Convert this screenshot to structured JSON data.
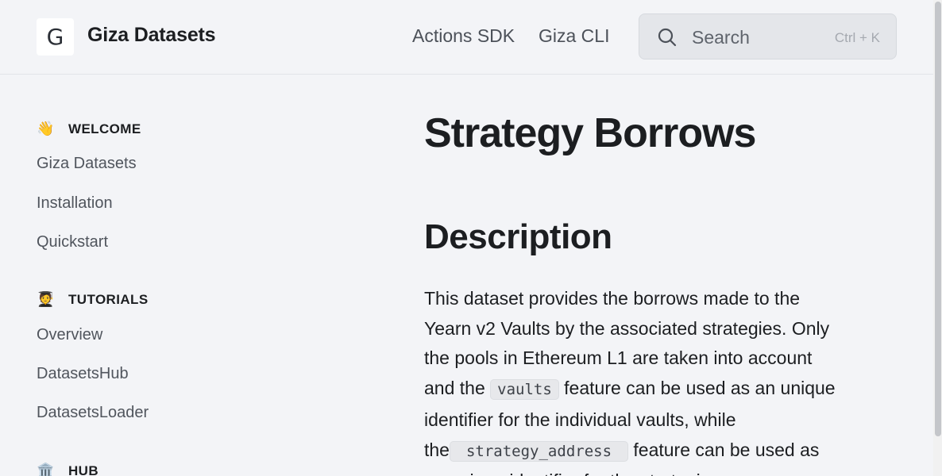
{
  "header": {
    "logo_letter": "G",
    "site_title": "Giza Datasets",
    "nav": [
      {
        "label": "Actions SDK"
      },
      {
        "label": "Giza CLI"
      }
    ],
    "search": {
      "placeholder": "Search",
      "shortcut": "Ctrl + K"
    }
  },
  "sidebar": {
    "sections": [
      {
        "emoji": "👋",
        "title": "WELCOME",
        "items": [
          "Giza Datasets",
          "Installation",
          "Quickstart"
        ]
      },
      {
        "emoji": "🧑‍🎓",
        "title": "TUTORIALS",
        "items": [
          "Overview",
          "DatasetsHub",
          "DatasetsLoader"
        ]
      },
      {
        "emoji": "🏛️",
        "title": "HUB",
        "items": []
      }
    ]
  },
  "main": {
    "title": "Strategy Borrows",
    "section_heading": "Description",
    "paragraph": {
      "part1": "This dataset provides the borrows made to the Yearn v2 Vaults by the associated strategies. Only the pools in Ethereum L1 are taken into account and the ",
      "code1": "vaults",
      "part2": " feature can be used as an unique identifier for the individual vaults, while the",
      "code2": "strategy_address",
      "part3": " feature can be used as an unique identifier for the strategies."
    }
  },
  "colors": {
    "background": "#f3f4f7",
    "text": "#1c1e21",
    "muted_text": "#50555d",
    "search_bg": "#e4e6ea"
  }
}
